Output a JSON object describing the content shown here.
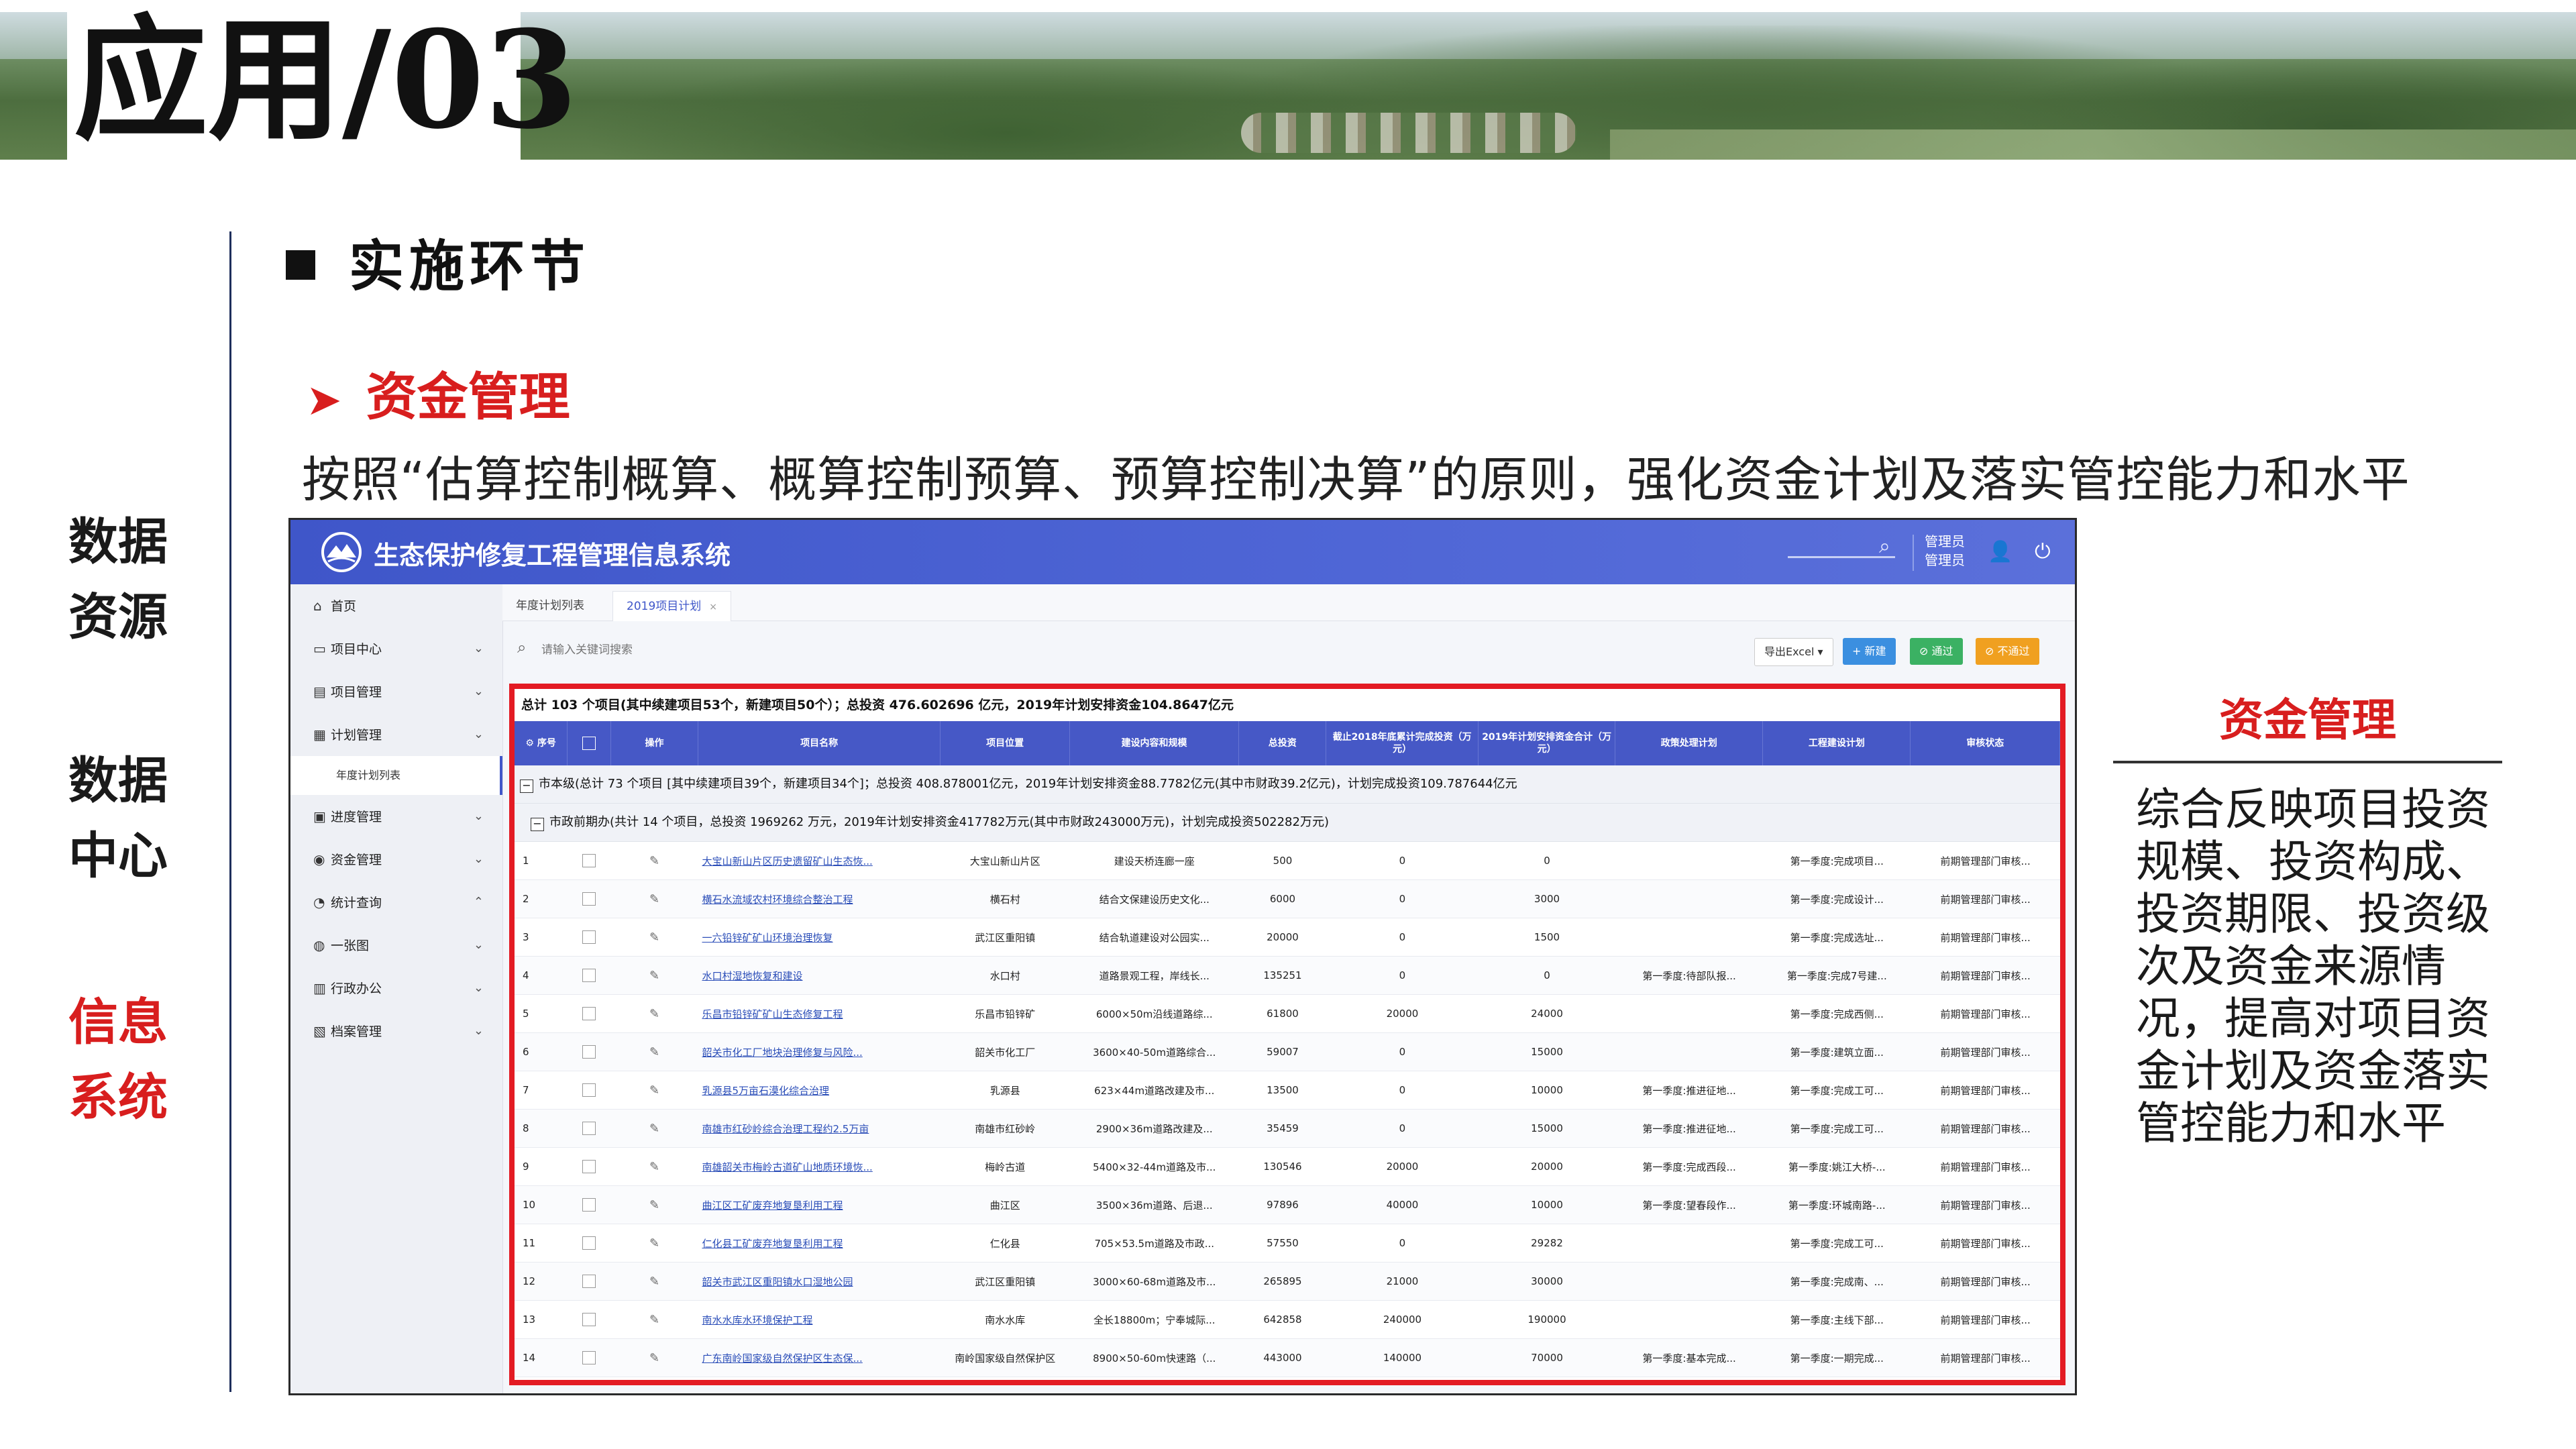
{
  "slide": {
    "title": "应用/03",
    "section_title": "实施环节",
    "subsection_title": "资金管理",
    "lead_text": "按照“估算控制概算、概算控制预算、预算控制决算”的原则，强化资金计划及落实管控能力和水平",
    "side_nav": [
      {
        "line1": "数据",
        "line2": "资源",
        "active": false
      },
      {
        "line1": "数据",
        "line2": "中心",
        "active": false
      },
      {
        "line1": "信息",
        "line2": "系统",
        "active": true
      }
    ],
    "right_panel": {
      "title": "资金管理",
      "body": "综合反映项目投资规模、投资构成、投资期限、投资级次及资金来源情况，提高对项目资金计划及资金落实管控能力和水平"
    }
  },
  "app": {
    "title": "生态保护修复工程管理信息系统",
    "user_line1": "管理员",
    "user_line2": "管理员",
    "nav": [
      {
        "label": "首页",
        "icon": "⌂",
        "chevron": ""
      },
      {
        "label": "项目中心",
        "icon": "▭",
        "chevron": "⌄"
      },
      {
        "label": "项目管理",
        "icon": "▤",
        "chevron": "⌄"
      },
      {
        "label": "计划管理",
        "icon": "▦",
        "chevron": "⌄"
      },
      {
        "label": "进度管理",
        "icon": "▣",
        "chevron": "⌄"
      },
      {
        "label": "资金管理",
        "icon": "◉",
        "chevron": "⌄"
      },
      {
        "label": "统计查询",
        "icon": "◔",
        "chevron": "⌃"
      },
      {
        "label": "一张图",
        "icon": "◍",
        "chevron": "⌄"
      },
      {
        "label": "行政办公",
        "icon": "▥",
        "chevron": "⌄"
      },
      {
        "label": "档案管理",
        "icon": "▧",
        "chevron": "⌄"
      }
    ],
    "nav_sub": "年度计划列表",
    "tabs": [
      {
        "label": "年度计划列表"
      },
      {
        "label": "2019项目计划",
        "close": "×"
      }
    ],
    "search_placeholder": "请输入关键词搜索",
    "buttons": {
      "export": "导出Excel ▾",
      "new": "+ 新建",
      "pass": "⊘ 通过",
      "nopass": "⊘ 不通过"
    },
    "summary": "总计 103 个项目(其中续建项目53个，新建项目50个）；总投资 476.602696 亿元，2019年计划安排资金104.8647亿元",
    "columns": [
      "序号",
      "",
      "操作",
      "项目名称",
      "项目位置",
      "建设内容和规模",
      "总投资",
      "截止2018年底累计完成投资（万元）",
      "2019年计划安排资金合计（万元）",
      "政策处理计划",
      "工程建设计划",
      "审核状态"
    ],
    "group1": "市本级(总计 73 个项目 [其中续建项目39个，新建项目34个]；总投资 408.878001亿元，2019年计划安排资金88.7782亿元(其中市财政39.2亿元)，计划完成投资109.787644亿元",
    "group2": "市政前期办(共计 14 个项目，总投资 1969262 万元，2019年计划安排资金417782万元(其中市财政243000万元)，计划完成投资502282万元)",
    "rows": [
      {
        "no": "1",
        "name": "大宝山新山片区历史遗留矿山生态恢...",
        "loc": "大宝山新山片区",
        "content": "建设天桥连廊一座",
        "total": "500",
        "done": "0",
        "plan": "0",
        "policy": "",
        "build": "第一季度:完成项目...",
        "status": "前期管理部门审核..."
      },
      {
        "no": "2",
        "name": "横石水流域农村环境综合整治工程",
        "loc": "横石村",
        "content": "结合文保建设历史文化...",
        "total": "6000",
        "done": "0",
        "plan": "3000",
        "policy": "",
        "build": "第一季度:完成设计...",
        "status": "前期管理部门审核..."
      },
      {
        "no": "3",
        "name": "一六铅锌矿矿山环境治理恢复",
        "loc": "武江区重阳镇",
        "content": "结合轨道建设对公园实...",
        "total": "20000",
        "done": "0",
        "plan": "1500",
        "policy": "",
        "build": "第一季度:完成选址...",
        "status": "前期管理部门审核..."
      },
      {
        "no": "4",
        "name": "水口村湿地恢复和建设",
        "loc": "水口村",
        "content": "道路景观工程，岸线长...",
        "total": "135251",
        "done": "0",
        "plan": "0",
        "policy": "第一季度:待部队报...",
        "build": "第一季度:完成7号建...",
        "status": "前期管理部门审核..."
      },
      {
        "no": "5",
        "name": "乐昌市铅锌矿矿山生态修复工程",
        "loc": "乐昌市铅锌矿",
        "content": "6000×50m沿线道路综...",
        "total": "61800",
        "done": "20000",
        "plan": "24000",
        "policy": "",
        "build": "第一季度:完成西侧...",
        "status": "前期管理部门审核..."
      },
      {
        "no": "6",
        "name": "韶关市化工厂地块治理修复与风险...",
        "loc": "韶关市化工厂",
        "content": "3600×40-50m道路综合...",
        "total": "59007",
        "done": "0",
        "plan": "15000",
        "policy": "",
        "build": "第一季度:建筑立面...",
        "status": "前期管理部门审核..."
      },
      {
        "no": "7",
        "name": "乳源县5万亩石漠化综合治理",
        "loc": "乳源县",
        "content": "623×44m道路改建及市...",
        "total": "13500",
        "done": "0",
        "plan": "10000",
        "policy": "第一季度:推进征地...",
        "build": "第一季度:完成工可...",
        "status": "前期管理部门审核..."
      },
      {
        "no": "8",
        "name": "南雄市红砂岭综合治理工程约2.5万亩",
        "loc": "南雄市红砂岭",
        "content": "2900×36m道路改建及...",
        "total": "35459",
        "done": "0",
        "plan": "15000",
        "policy": "第一季度:推进征地...",
        "build": "第一季度:完成工可...",
        "status": "前期管理部门审核..."
      },
      {
        "no": "9",
        "name": "南雄韶关市梅岭古道矿山地质环境恢...",
        "loc": "梅岭古道",
        "content": "5400×32-44m道路及市...",
        "total": "130546",
        "done": "20000",
        "plan": "20000",
        "policy": "第一季度:完成西段...",
        "build": "第一季度:姚江大桥-...",
        "status": "前期管理部门审核..."
      },
      {
        "no": "10",
        "name": "曲江区工矿废弃地复垦利用工程",
        "loc": "曲江区",
        "content": "3500×36m道路、后退...",
        "total": "97896",
        "done": "40000",
        "plan": "10000",
        "policy": "第一季度:望春段作...",
        "build": "第一季度:环城南路-...",
        "status": "前期管理部门审核..."
      },
      {
        "no": "11",
        "name": "仁化县工矿废弃地复垦利用工程",
        "loc": "仁化县",
        "content": "705×53.5m道路及市政...",
        "total": "57550",
        "done": "0",
        "plan": "29282",
        "policy": "",
        "build": "第一季度:完成工可...",
        "status": "前期管理部门审核..."
      },
      {
        "no": "12",
        "name": "韶关市武江区重阳镇水口湿地公园",
        "loc": "武江区重阳镇",
        "content": "3000×60-68m道路及市...",
        "total": "265895",
        "done": "21000",
        "plan": "30000",
        "policy": "",
        "build": "第一季度:完成南、...",
        "status": "前期管理部门审核..."
      },
      {
        "no": "13",
        "name": "南水水库水环境保护工程",
        "loc": "南水水库",
        "content": "全长18800m；宁奉城际...",
        "total": "642858",
        "done": "240000",
        "plan": "190000",
        "policy": "",
        "build": "第一季度:主线下部...",
        "status": "前期管理部门审核..."
      },
      {
        "no": "14",
        "name": "广东南岭国家级自然保护区生态保...",
        "loc": "南岭国家级自然保护区",
        "content": "8900×50-60m快速路（...",
        "total": "443000",
        "done": "140000",
        "plan": "70000",
        "policy": "第一季度:基本完成...",
        "build": "第一季度:一期完成...",
        "status": "前期管理部门审核..."
      }
    ]
  }
}
